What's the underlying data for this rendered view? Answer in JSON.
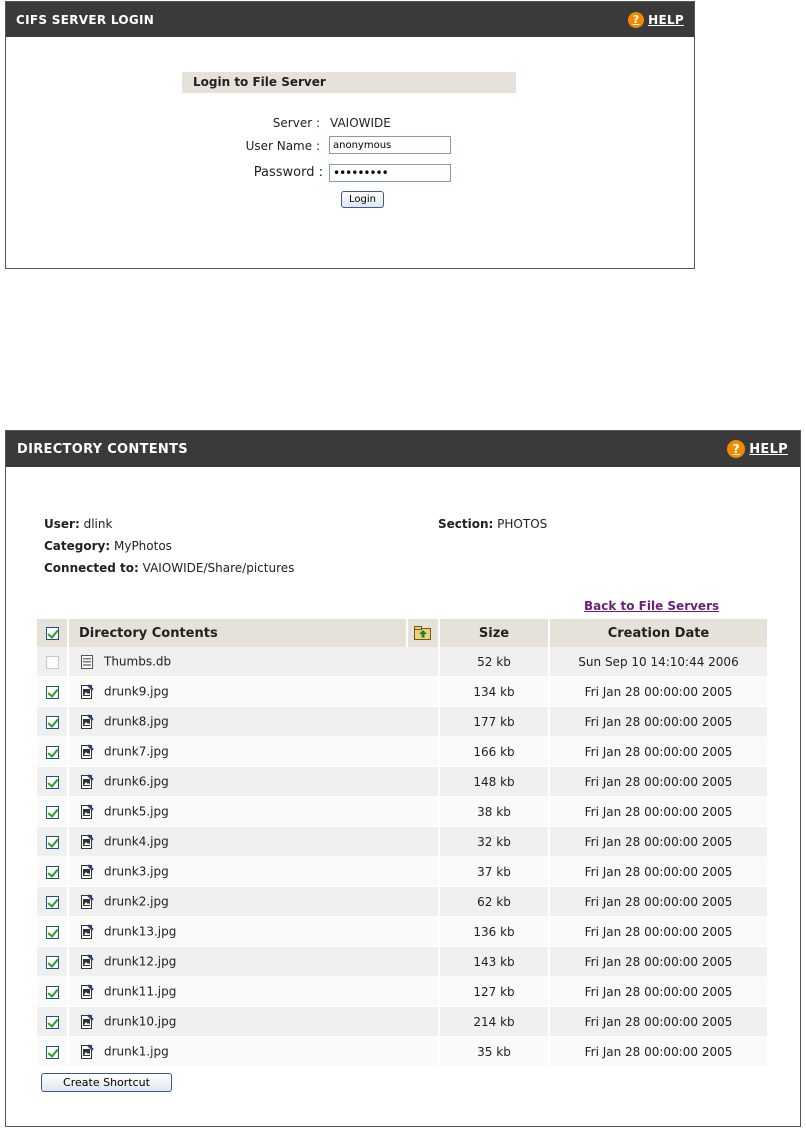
{
  "login_panel": {
    "title": "CIFS SERVER LOGIN",
    "help_label": "HELP",
    "help_icon": "?",
    "section_title": "Login to File Server",
    "server_label": "Server :",
    "server_value": "VAIOWIDE",
    "username_label": "User Name :",
    "username_value": "anonymous",
    "password_label": "Password :",
    "password_value": "•••••••••",
    "login_button": "Login"
  },
  "directory_panel": {
    "title": "DIRECTORY CONTENTS",
    "help_label": "HELP",
    "help_icon": "?",
    "user_label": "User:",
    "user_value": "dlink",
    "section_label": "Section:",
    "section_value": "PHOTOS",
    "category_label": "Category:",
    "category_value": "MyPhotos",
    "connected_label": "Connected to:",
    "connected_value": "VAIOWIDE/Share/pictures",
    "back_link": "Back to File Servers",
    "columns": {
      "name": "Directory Contents",
      "size": "Size",
      "date": "Creation Date"
    },
    "create_shortcut": "Create Shortcut",
    "rows": [
      {
        "checked": false,
        "icon": "database-file-icon",
        "name": "Thumbs.db",
        "size": "52 kb",
        "date": "Sun Sep 10 14:10:44 2006"
      },
      {
        "checked": true,
        "icon": "image-file-icon",
        "name": "drunk9.jpg",
        "size": "134 kb",
        "date": "Fri Jan 28 00:00:00 2005"
      },
      {
        "checked": true,
        "icon": "image-file-icon",
        "name": "drunk8.jpg",
        "size": "177 kb",
        "date": "Fri Jan 28 00:00:00 2005"
      },
      {
        "checked": true,
        "icon": "image-file-icon",
        "name": "drunk7.jpg",
        "size": "166 kb",
        "date": "Fri Jan 28 00:00:00 2005"
      },
      {
        "checked": true,
        "icon": "image-file-icon",
        "name": "drunk6.jpg",
        "size": "148 kb",
        "date": "Fri Jan 28 00:00:00 2005"
      },
      {
        "checked": true,
        "icon": "image-file-icon",
        "name": "drunk5.jpg",
        "size": "38 kb",
        "date": "Fri Jan 28 00:00:00 2005"
      },
      {
        "checked": true,
        "icon": "image-file-icon",
        "name": "drunk4.jpg",
        "size": "32 kb",
        "date": "Fri Jan 28 00:00:00 2005"
      },
      {
        "checked": true,
        "icon": "image-file-icon",
        "name": "drunk3.jpg",
        "size": "37 kb",
        "date": "Fri Jan 28 00:00:00 2005"
      },
      {
        "checked": true,
        "icon": "image-file-icon",
        "name": "drunk2.jpg",
        "size": "62 kb",
        "date": "Fri Jan 28 00:00:00 2005"
      },
      {
        "checked": true,
        "icon": "image-file-icon",
        "name": "drunk13.jpg",
        "size": "136 kb",
        "date": "Fri Jan 28 00:00:00 2005"
      },
      {
        "checked": true,
        "icon": "image-file-icon",
        "name": "drunk12.jpg",
        "size": "143 kb",
        "date": "Fri Jan 28 00:00:00 2005"
      },
      {
        "checked": true,
        "icon": "image-file-icon",
        "name": "drunk11.jpg",
        "size": "127 kb",
        "date": "Fri Jan 28 00:00:00 2005"
      },
      {
        "checked": true,
        "icon": "image-file-icon",
        "name": "drunk10.jpg",
        "size": "214 kb",
        "date": "Fri Jan 28 00:00:00 2005"
      },
      {
        "checked": true,
        "icon": "image-file-icon",
        "name": "drunk1.jpg",
        "size": "35 kb",
        "date": "Fri Jan 28 00:00:00 2005"
      }
    ]
  },
  "colors": {
    "header_bg": "#3a3a3a",
    "help_accent": "#f08a00",
    "section_bg": "#e6e2da",
    "link": "#6b1f7a",
    "check": "#21a121"
  }
}
